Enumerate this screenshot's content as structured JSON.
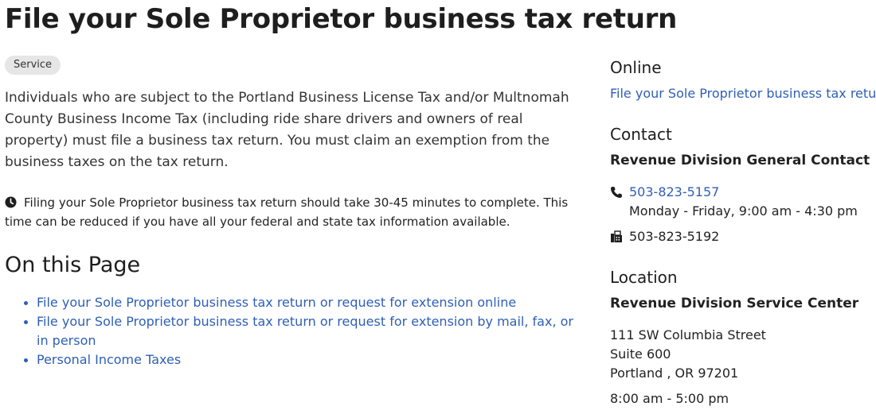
{
  "page": {
    "title": "File your Sole Proprietor business tax return"
  },
  "main": {
    "badge": "Service",
    "intro": "Individuals who are subject to the Portland Business License Tax and/or Multnomah County Business Income Tax (including ride share drivers and owners of real property) must file a business tax return. You must claim an exemption from the business taxes on the tax return.",
    "notice_icon": "clock-icon",
    "notice": "Filing your Sole Proprietor business tax return should take 30-45 minutes to complete. This time can be reduced if you have all your federal and state tax information available.",
    "on_this_page": {
      "heading": "On this Page",
      "items": [
        {
          "label": "File your Sole Proprietor business tax return or request for extension online"
        },
        {
          "label": "File your Sole Proprietor business tax return or request for extension by mail, fax, or in person"
        },
        {
          "label": "Personal Income Taxes"
        }
      ]
    }
  },
  "sidebar": {
    "online": {
      "heading": "Online",
      "link": "File your Sole Proprietor business tax return"
    },
    "contact": {
      "heading": "Contact",
      "name": "Revenue Division General Contact",
      "phone_icon": "phone-icon",
      "phone": "503-823-5157",
      "hours": "Monday - Friday, 9:00 am - 4:30 pm",
      "fax_icon": "fax-icon",
      "fax": "503-823-5192"
    },
    "location": {
      "heading": "Location",
      "name": "Revenue Division Service Center",
      "address_line1": "111 SW Columbia Street",
      "address_line2": "Suite 600",
      "address_line3": "Portland , OR 97201",
      "hours": "8:00 am - 5:00 pm"
    }
  },
  "colors": {
    "link": "#2e5fb6",
    "badge_bg": "#e6e6e6",
    "text": "#1e1e1e"
  }
}
